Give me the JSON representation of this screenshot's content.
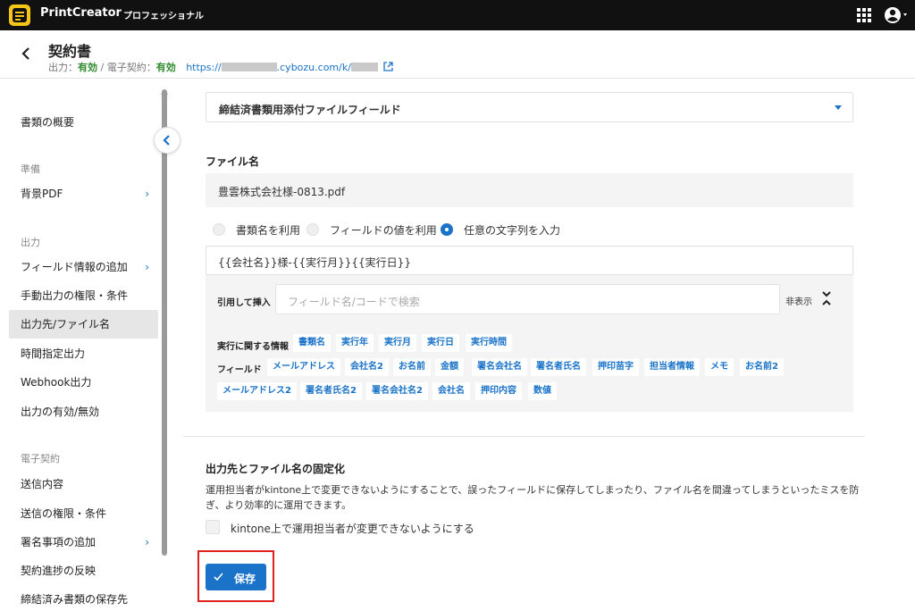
{
  "topbar": {
    "brand": "PrintCreator",
    "edition": "プロフェッショナル"
  },
  "header": {
    "title": "契約書",
    "output_label": "出力：",
    "output_status": "有効",
    "separator": " / ",
    "esign_label": "電子契約：",
    "esign_status": "有効",
    "url_prefix": "https://",
    "url_mid": ".cybozu.com/k/"
  },
  "sidebar": {
    "overview": "書類の概要",
    "sections": {
      "prep": "準備",
      "output": "出力",
      "esign": "電子契約"
    },
    "items": [
      {
        "label": "背景PDF",
        "chevron": true
      },
      {
        "label": "フィールド情報の追加",
        "chevron": true
      },
      {
        "label": "手動出力の権限・条件"
      },
      {
        "label": "出力先/ファイル名"
      },
      {
        "label": "時間指定出力"
      },
      {
        "label": "Webhook出力"
      },
      {
        "label": "出力の有効/無効"
      },
      {
        "label": "送信内容"
      },
      {
        "label": "送信の権限・条件"
      },
      {
        "label": "署名事項の追加",
        "chevron": true
      },
      {
        "label": "契約進捗の反映"
      },
      {
        "label": "締結済み書類の保存先"
      }
    ]
  },
  "main": {
    "dropdown_value": "締結済書類用添付ファイルフィールド",
    "filename_label": "ファイル名",
    "filename_preview": "豊雲株式会社様-0813.pdf",
    "radio_options": [
      "書類名を利用",
      "フィールドの値を利用",
      "任意の文字列を入力"
    ],
    "radio_selected": "任意の文字列を入力",
    "filename_input_value": "{{会社名}}様-{{実行月}}{{実行日}}",
    "insert": {
      "label": "引用して挿入",
      "search_placeholder": "フィールド名/コードで検索",
      "hide_label": "非表示",
      "exec_label": "実行に関する情報",
      "exec_chips": [
        "書類名",
        "実行年",
        "実行月",
        "実行日",
        "実行時間"
      ],
      "field_label": "フィールド",
      "field_chips_row1": [
        "メールアドレス",
        "会社名2",
        "お名前",
        "金額",
        "署名会社名",
        "署名者氏名",
        "押印苗字",
        "担当者情報",
        "メモ",
        "お名前2"
      ],
      "field_chips_row2": [
        "メールアドレス2",
        "署名者氏名2",
        "署名会社名2",
        "会社名",
        "押印内容",
        "数値"
      ]
    },
    "lock_section": {
      "title": "出力先とファイル名の固定化",
      "description": "運用担当者がkintone上で変更できないようにすることで、誤ったフィールドに保存してしまったり、ファイル名を間違ってしまうといったミスを防ぎ、より効率的に運用できます。",
      "checkbox_label": "kintone上で運用担当者が変更できないようにする",
      "checkbox_checked": false
    },
    "save_label": "保存"
  },
  "colors": {
    "accent": "#1a73c8",
    "brand_yellow": "#f5c518",
    "ok_green": "#2e8b2e",
    "highlight_red": "#e0201c"
  },
  "icons": [
    "printcreator-logo-icon",
    "apps-grid-icon",
    "user-account-icon",
    "back-arrow-icon",
    "external-link-icon",
    "chevron-left-icon",
    "chevron-right-icon",
    "dropdown-caret-icon",
    "collapse-icon",
    "check-icon"
  ]
}
